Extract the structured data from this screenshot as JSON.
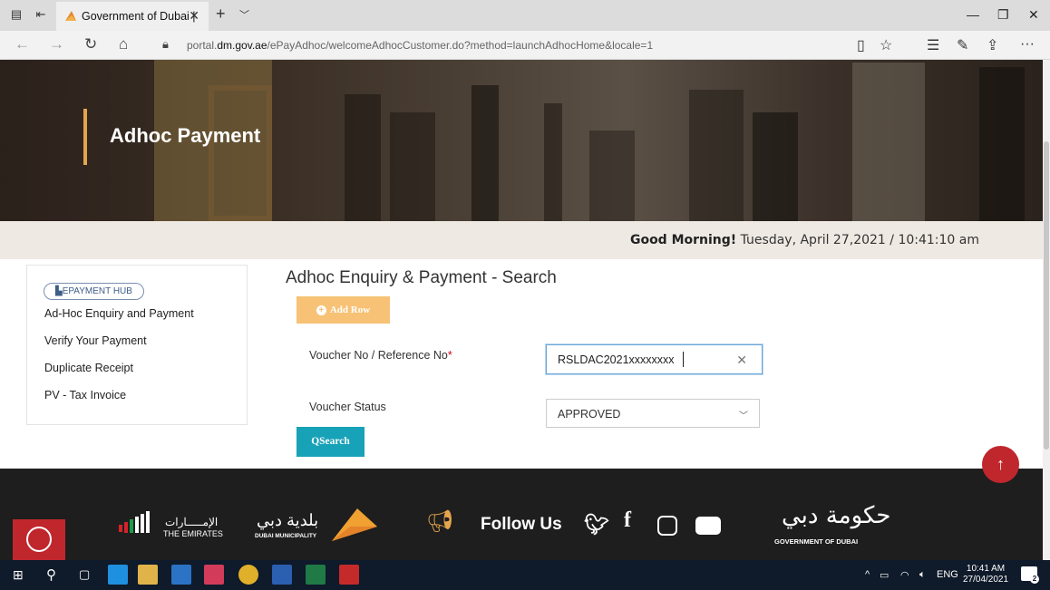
{
  "browser": {
    "tab_title": "Government of Dubai |",
    "url_prefix": "portal.",
    "url_domain": "dm.gov.ae",
    "url_path": "/ePayAdhoc/welcomeAdhocCustomer.do?method=launchAdhocHome&locale=1"
  },
  "hero": {
    "title": "Adhoc Payment"
  },
  "greeting": {
    "salutation": "Good Morning!",
    "date": "Tuesday, April 27,2021",
    "separator": "/",
    "time": "10:41:10 am"
  },
  "sidebar": {
    "hub_label": "EPAYMENT HUB",
    "items": [
      {
        "label": "Ad-Hoc Enquiry and Payment"
      },
      {
        "label": "Verify Your Payment"
      },
      {
        "label": "Duplicate Receipt"
      },
      {
        "label": "PV - Tax Invoice"
      }
    ]
  },
  "form": {
    "title": "Adhoc Enquiry & Payment - Search",
    "add_row_label": "Add Row",
    "voucher_label": "Voucher No / Reference No",
    "required_mark": "*",
    "voucher_value": "RSLDAC2021xxxxxxxx",
    "status_label": "Voucher Status",
    "status_value": "APPROVED",
    "search_label": "Search"
  },
  "footer": {
    "uae_ar": "الإمـــــارات",
    "uae_en": "THE EMIRATES",
    "dm_ar": "بلدية دبي",
    "dm_en": "DUBAI MUNICIPALITY",
    "follow_label": "Follow Us",
    "gov_ar": "حكومة دبي",
    "gov_en": "GOVERNMENT OF DUBAI"
  },
  "taskbar": {
    "language": "ENG",
    "time": "10:41 AM",
    "date": "27/04/2021",
    "notification_count": "2"
  },
  "colors": {
    "accent_gold": "#e4a54e",
    "add_row_bg": "#f7c276",
    "search_bg": "#17a2b8",
    "totop_bg": "#c0272d",
    "footer_bg": "#1e1e1e"
  }
}
